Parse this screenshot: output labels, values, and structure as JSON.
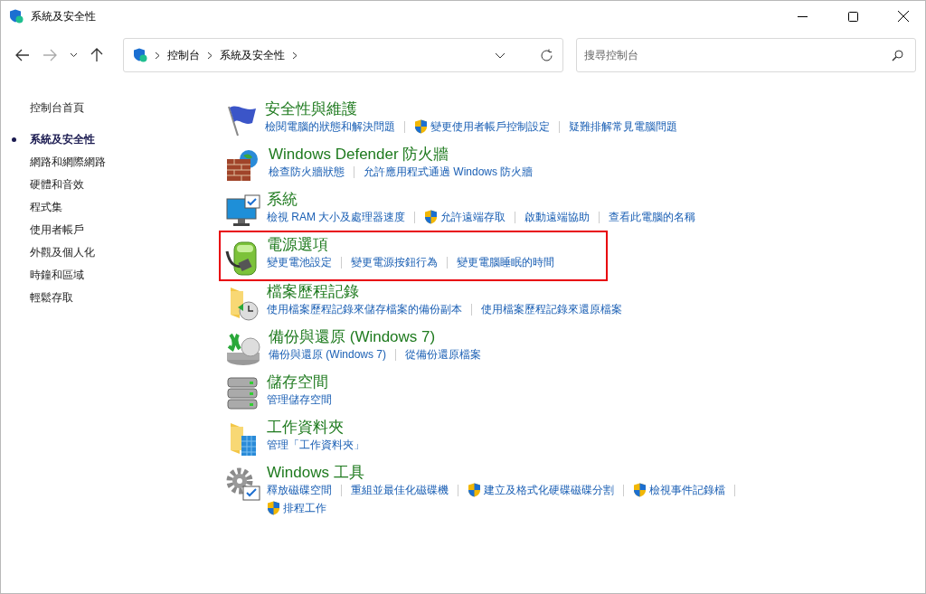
{
  "window": {
    "title": "系統及安全性"
  },
  "address_bar": {
    "crumbs": [
      "控制台",
      "系統及安全性"
    ]
  },
  "search": {
    "placeholder": "搜尋控制台"
  },
  "sidebar": {
    "home": "控制台首頁",
    "items": [
      {
        "label": "系統及安全性",
        "selected": true
      },
      {
        "label": "網路和網際網路",
        "selected": false
      },
      {
        "label": "硬體和音效",
        "selected": false
      },
      {
        "label": "程式集",
        "selected": false
      },
      {
        "label": "使用者帳戶",
        "selected": false
      },
      {
        "label": "外觀及個人化",
        "selected": false
      },
      {
        "label": "時鐘和區域",
        "selected": false
      },
      {
        "label": "輕鬆存取",
        "selected": false
      }
    ]
  },
  "categories": [
    {
      "kind": "flag",
      "title": "安全性與維護",
      "highlighted": false,
      "links": [
        {
          "label": "檢閱電腦的狀態和解決問題",
          "shield": false
        },
        {
          "label": "變更使用者帳戶控制設定",
          "shield": true
        },
        {
          "label": "疑難排解常見電腦問題",
          "shield": false
        }
      ]
    },
    {
      "kind": "firewall",
      "title": "Windows Defender 防火牆",
      "highlighted": false,
      "links": [
        {
          "label": "檢查防火牆狀態",
          "shield": false
        },
        {
          "label": "允許應用程式通過 Windows 防火牆",
          "shield": false
        }
      ]
    },
    {
      "kind": "monitor",
      "title": "系統",
      "highlighted": false,
      "links": [
        {
          "label": "檢視 RAM 大小及處理器速度",
          "shield": false
        },
        {
          "label": "允許遠端存取",
          "shield": true
        },
        {
          "label": "啟動遠端協助",
          "shield": false
        },
        {
          "label": "查看此電腦的名稱",
          "shield": false
        }
      ]
    },
    {
      "kind": "battery",
      "title": "電源選項",
      "highlighted": true,
      "links": [
        {
          "label": "變更電池設定",
          "shield": false
        },
        {
          "label": "變更電源按鈕行為",
          "shield": false
        },
        {
          "label": "變更電腦睡眠的時間",
          "shield": false
        }
      ]
    },
    {
      "kind": "history",
      "title": "檔案歷程記錄",
      "highlighted": false,
      "links": [
        {
          "label": "使用檔案歷程記錄來儲存檔案的備份副本",
          "shield": false
        },
        {
          "label": "使用檔案歷程記錄來還原檔案",
          "shield": false
        }
      ]
    },
    {
      "kind": "backup",
      "title": "備份與還原 (Windows 7)",
      "highlighted": false,
      "links": [
        {
          "label": "備份與還原 (Windows 7)",
          "shield": false
        },
        {
          "label": "從備份還原檔案",
          "shield": false
        }
      ]
    },
    {
      "kind": "storage",
      "title": "儲存空間",
      "highlighted": false,
      "links": [
        {
          "label": "管理儲存空間",
          "shield": false
        }
      ]
    },
    {
      "kind": "workfolder",
      "title": "工作資料夾",
      "highlighted": false,
      "links": [
        {
          "label": "管理「工作資料夾」",
          "shield": false
        }
      ]
    },
    {
      "kind": "tools",
      "title": "Windows 工具",
      "highlighted": false,
      "links": [
        {
          "label": "釋放磁碟空間",
          "shield": false
        },
        {
          "label": "重組並最佳化磁碟機",
          "shield": false
        },
        {
          "label": "建立及格式化硬碟磁碟分割",
          "shield": true
        },
        {
          "label": "檢視事件記錄檔",
          "shield": true
        },
        {
          "label": "排程工作",
          "shield": true
        }
      ]
    }
  ]
}
